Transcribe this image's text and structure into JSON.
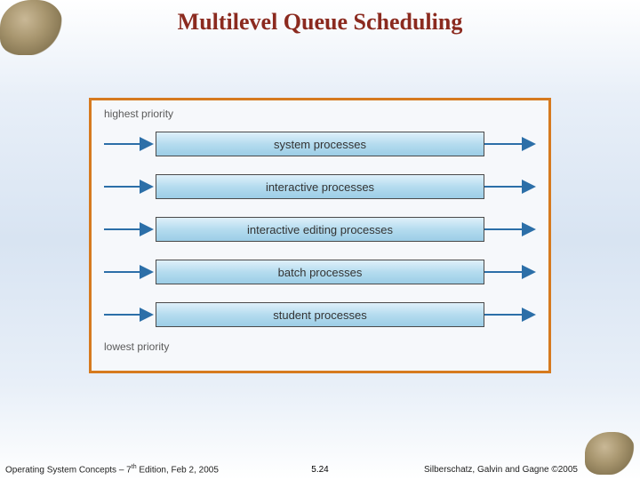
{
  "title": "Multilevel Queue Scheduling",
  "priority_high": "highest priority",
  "priority_low": "lowest priority",
  "queues": {
    "q0": "system processes",
    "q1": "interactive processes",
    "q2": "interactive editing processes",
    "q3": "batch processes",
    "q4": "student processes"
  },
  "footer": {
    "left_pre": "Operating System Concepts – 7",
    "left_sup": "th",
    "left_post": " Edition, Feb 2, 2005",
    "center": "5.24",
    "right": "Silberschatz, Galvin and Gagne ©2005"
  }
}
